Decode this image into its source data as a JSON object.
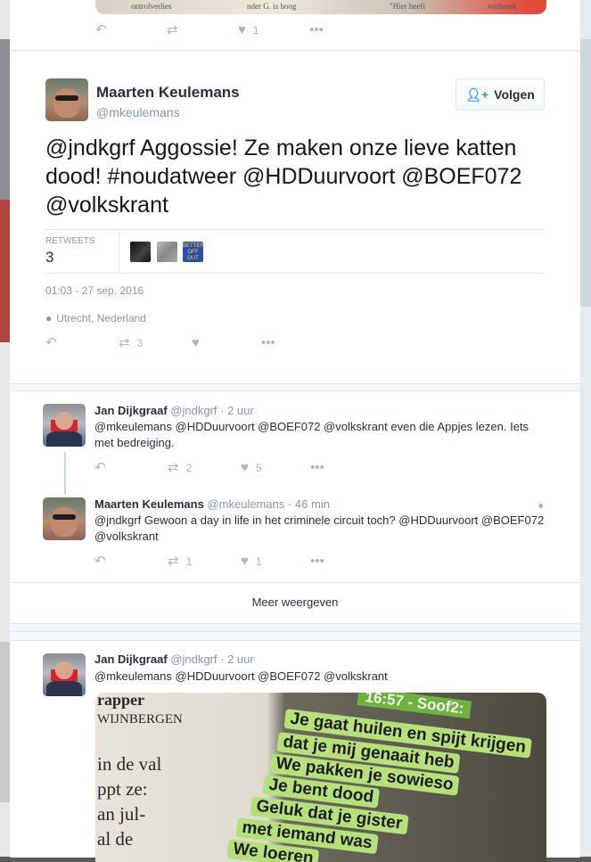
{
  "colors": {
    "accent": "#1da1f2",
    "muted": "#8899a6",
    "icon": "#aab8c2",
    "border": "#e1e8ed"
  },
  "top_card": {
    "photo_snippets": [
      "ontrolverlies",
      "nder G. is hoog",
      "\"Hier heeft",
      "wetbreek"
    ],
    "actions": {
      "reply_icon": "reply-icon",
      "retweet_icon": "retweet-icon",
      "like_icon": "heart-icon",
      "like_count": "1",
      "more_icon": "more-icon"
    }
  },
  "main_tweet": {
    "name": "Maarten Keulemans",
    "handle": "@mkeulemans",
    "follow_label": "Volgen",
    "text": "@jndkgrf Aggossie! Ze maken onze lieve katten dood! #noudatweer @HDDuurvoort @BOEF072 @volkskrant",
    "retweets_label": "RETWEETS",
    "retweets_count": "3",
    "badge_text": [
      "BETTER",
      "OFF",
      "OUT"
    ],
    "timestamp": "01:03 - 27 sep. 2016",
    "location": "Utrecht, Nederland",
    "actions": {
      "retweet_count": "3"
    }
  },
  "replies": [
    {
      "name": "Jan Dijkgraaf",
      "handle": "@jndkgrf",
      "time": "· 2 uur",
      "text": "@mkeulemans @HDDuurvoort @BOEF072 @volkskrant even die Appjes lezen. Iets met bedreiging.",
      "retweet_count": "2",
      "like_count": "5"
    },
    {
      "name": "Maarten Keulemans",
      "handle": "@mkeulemans",
      "time": "· 46 min",
      "text": "@jndkgrf Gewoon a day in life in het criminele circuit toch? @HDDuurvoort @BOEF072 @volkskrant",
      "retweet_count": "1",
      "like_count": "1"
    }
  ],
  "more_label": "Meer weergeven",
  "bottom_tweet": {
    "name": "Jan Dijkgraaf",
    "handle": "@jndkgrf",
    "time": "· 2 uur",
    "text": "@mkeulemans @HDDuurvoort @BOEF072 @volkskrant",
    "photo_left_text": [
      "rapper",
      "WIJNBERGEN",
      "in de val",
      "ppt ze:",
      "an jul-",
      "al de"
    ],
    "photo_header": "16:57 - Soof2:",
    "photo_bubbles": [
      "Je gaat huilen en spijt krijgen",
      "dat je mij genaait heb",
      "We pakken je sowieso",
      "Je bent dood",
      "Geluk dat je gister",
      "met iemand was",
      "We loeren"
    ]
  }
}
